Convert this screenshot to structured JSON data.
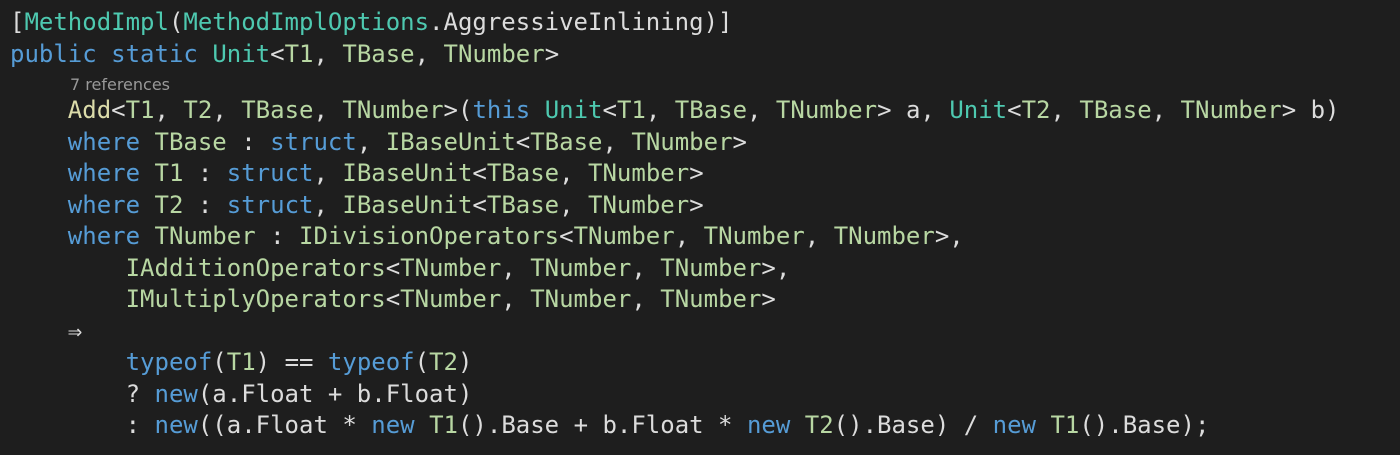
{
  "editor": {
    "background": "#1e1e1e",
    "codelens": "7 references",
    "colors": {
      "keyword": "#569cd6",
      "type": "#4ec9b0",
      "type_param": "#b8d7a3",
      "method": "#dcdcaa",
      "plain": "#dcdcdc",
      "codelens": "#999999"
    },
    "lines": [
      [
        {
          "t": "[",
          "c": "pl"
        },
        {
          "t": "MethodImpl",
          "c": "attr"
        },
        {
          "t": "(",
          "c": "pl"
        },
        {
          "t": "MethodImplOptions",
          "c": "ty"
        },
        {
          "t": ".AggressiveInlining)]",
          "c": "pl"
        }
      ],
      [
        {
          "t": "public",
          "c": "kw"
        },
        {
          "t": " ",
          "c": "pl"
        },
        {
          "t": "static",
          "c": "kw"
        },
        {
          "t": " ",
          "c": "pl"
        },
        {
          "t": "Unit",
          "c": "ty"
        },
        {
          "t": "<",
          "c": "pl"
        },
        {
          "t": "T1",
          "c": "tp"
        },
        {
          "t": ", ",
          "c": "pl"
        },
        {
          "t": "TBase",
          "c": "tp"
        },
        {
          "t": ", ",
          "c": "pl"
        },
        {
          "t": "TNumber",
          "c": "tp"
        },
        {
          "t": ">",
          "c": "pl"
        }
      ],
      [
        {
          "t": "    ",
          "c": "pl"
        },
        {
          "t": "Add",
          "c": "fn"
        },
        {
          "t": "<",
          "c": "pl"
        },
        {
          "t": "T1",
          "c": "tp"
        },
        {
          "t": ", ",
          "c": "pl"
        },
        {
          "t": "T2",
          "c": "tp"
        },
        {
          "t": ", ",
          "c": "pl"
        },
        {
          "t": "TBase",
          "c": "tp"
        },
        {
          "t": ", ",
          "c": "pl"
        },
        {
          "t": "TNumber",
          "c": "tp"
        },
        {
          "t": ">(",
          "c": "pl"
        },
        {
          "t": "this",
          "c": "kw"
        },
        {
          "t": " ",
          "c": "pl"
        },
        {
          "t": "Unit",
          "c": "ty"
        },
        {
          "t": "<",
          "c": "pl"
        },
        {
          "t": "T1",
          "c": "tp"
        },
        {
          "t": ", ",
          "c": "pl"
        },
        {
          "t": "TBase",
          "c": "tp"
        },
        {
          "t": ", ",
          "c": "pl"
        },
        {
          "t": "TNumber",
          "c": "tp"
        },
        {
          "t": "> a, ",
          "c": "pl"
        },
        {
          "t": "Unit",
          "c": "ty"
        },
        {
          "t": "<",
          "c": "pl"
        },
        {
          "t": "T2",
          "c": "tp"
        },
        {
          "t": ", ",
          "c": "pl"
        },
        {
          "t": "TBase",
          "c": "tp"
        },
        {
          "t": ", ",
          "c": "pl"
        },
        {
          "t": "TNumber",
          "c": "tp"
        },
        {
          "t": "> b)",
          "c": "pl"
        }
      ],
      [
        {
          "t": "    ",
          "c": "pl"
        },
        {
          "t": "where",
          "c": "kw"
        },
        {
          "t": " ",
          "c": "pl"
        },
        {
          "t": "TBase",
          "c": "tp"
        },
        {
          "t": " : ",
          "c": "pl"
        },
        {
          "t": "struct",
          "c": "kw"
        },
        {
          "t": ", ",
          "c": "pl"
        },
        {
          "t": "IBaseUnit",
          "c": "tp"
        },
        {
          "t": "<",
          "c": "pl"
        },
        {
          "t": "TBase",
          "c": "tp"
        },
        {
          "t": ", ",
          "c": "pl"
        },
        {
          "t": "TNumber",
          "c": "tp"
        },
        {
          "t": ">",
          "c": "pl"
        }
      ],
      [
        {
          "t": "    ",
          "c": "pl"
        },
        {
          "t": "where",
          "c": "kw"
        },
        {
          "t": " ",
          "c": "pl"
        },
        {
          "t": "T1",
          "c": "tp"
        },
        {
          "t": " : ",
          "c": "pl"
        },
        {
          "t": "struct",
          "c": "kw"
        },
        {
          "t": ", ",
          "c": "pl"
        },
        {
          "t": "IBaseUnit",
          "c": "tp"
        },
        {
          "t": "<",
          "c": "pl"
        },
        {
          "t": "TBase",
          "c": "tp"
        },
        {
          "t": ", ",
          "c": "pl"
        },
        {
          "t": "TNumber",
          "c": "tp"
        },
        {
          "t": ">",
          "c": "pl"
        }
      ],
      [
        {
          "t": "    ",
          "c": "pl"
        },
        {
          "t": "where",
          "c": "kw"
        },
        {
          "t": " ",
          "c": "pl"
        },
        {
          "t": "T2",
          "c": "tp"
        },
        {
          "t": " : ",
          "c": "pl"
        },
        {
          "t": "struct",
          "c": "kw"
        },
        {
          "t": ", ",
          "c": "pl"
        },
        {
          "t": "IBaseUnit",
          "c": "tp"
        },
        {
          "t": "<",
          "c": "pl"
        },
        {
          "t": "TBase",
          "c": "tp"
        },
        {
          "t": ", ",
          "c": "pl"
        },
        {
          "t": "TNumber",
          "c": "tp"
        },
        {
          "t": ">",
          "c": "pl"
        }
      ],
      [
        {
          "t": "    ",
          "c": "pl"
        },
        {
          "t": "where",
          "c": "kw"
        },
        {
          "t": " ",
          "c": "pl"
        },
        {
          "t": "TNumber",
          "c": "tp"
        },
        {
          "t": " : ",
          "c": "pl"
        },
        {
          "t": "IDivisionOperators",
          "c": "tp"
        },
        {
          "t": "<",
          "c": "pl"
        },
        {
          "t": "TNumber",
          "c": "tp"
        },
        {
          "t": ", ",
          "c": "pl"
        },
        {
          "t": "TNumber",
          "c": "tp"
        },
        {
          "t": ", ",
          "c": "pl"
        },
        {
          "t": "TNumber",
          "c": "tp"
        },
        {
          "t": ">,",
          "c": "pl"
        }
      ],
      [
        {
          "t": "        ",
          "c": "pl"
        },
        {
          "t": "IAdditionOperators",
          "c": "tp"
        },
        {
          "t": "<",
          "c": "pl"
        },
        {
          "t": "TNumber",
          "c": "tp"
        },
        {
          "t": ", ",
          "c": "pl"
        },
        {
          "t": "TNumber",
          "c": "tp"
        },
        {
          "t": ", ",
          "c": "pl"
        },
        {
          "t": "TNumber",
          "c": "tp"
        },
        {
          "t": ">,",
          "c": "pl"
        }
      ],
      [
        {
          "t": "        ",
          "c": "pl"
        },
        {
          "t": "IMultiplyOperators",
          "c": "tp"
        },
        {
          "t": "<",
          "c": "pl"
        },
        {
          "t": "TNumber",
          "c": "tp"
        },
        {
          "t": ", ",
          "c": "pl"
        },
        {
          "t": "TNumber",
          "c": "tp"
        },
        {
          "t": ", ",
          "c": "pl"
        },
        {
          "t": "TNumber",
          "c": "tp"
        },
        {
          "t": ">",
          "c": "pl"
        }
      ],
      [
        {
          "t": "    ",
          "c": "pl"
        },
        {
          "t": "⇒",
          "c": "pl"
        }
      ],
      [
        {
          "t": "        ",
          "c": "pl"
        },
        {
          "t": "typeof",
          "c": "kw"
        },
        {
          "t": "(",
          "c": "pl"
        },
        {
          "t": "T1",
          "c": "tp"
        },
        {
          "t": ") ",
          "c": "pl"
        },
        {
          "t": "==",
          "c": "pl"
        },
        {
          "t": " ",
          "c": "pl"
        },
        {
          "t": "typeof",
          "c": "kw"
        },
        {
          "t": "(",
          "c": "pl"
        },
        {
          "t": "T2",
          "c": "tp"
        },
        {
          "t": ")",
          "c": "pl"
        }
      ],
      [
        {
          "t": "        ",
          "c": "pl"
        },
        {
          "t": "? ",
          "c": "pl"
        },
        {
          "t": "new",
          "c": "kw"
        },
        {
          "t": "(a.Float + b.Float)",
          "c": "pl"
        }
      ],
      [
        {
          "t": "        ",
          "c": "pl"
        },
        {
          "t": ": ",
          "c": "pl"
        },
        {
          "t": "new",
          "c": "kw"
        },
        {
          "t": "((a.Float * ",
          "c": "pl"
        },
        {
          "t": "new",
          "c": "kw"
        },
        {
          "t": " ",
          "c": "pl"
        },
        {
          "t": "T1",
          "c": "tp"
        },
        {
          "t": "().Base + b.Float * ",
          "c": "pl"
        },
        {
          "t": "new",
          "c": "kw"
        },
        {
          "t": " ",
          "c": "pl"
        },
        {
          "t": "T2",
          "c": "tp"
        },
        {
          "t": "().Base) / ",
          "c": "pl"
        },
        {
          "t": "new",
          "c": "kw"
        },
        {
          "t": " ",
          "c": "pl"
        },
        {
          "t": "T1",
          "c": "tp"
        },
        {
          "t": "().Base);",
          "c": "pl"
        }
      ]
    ]
  }
}
